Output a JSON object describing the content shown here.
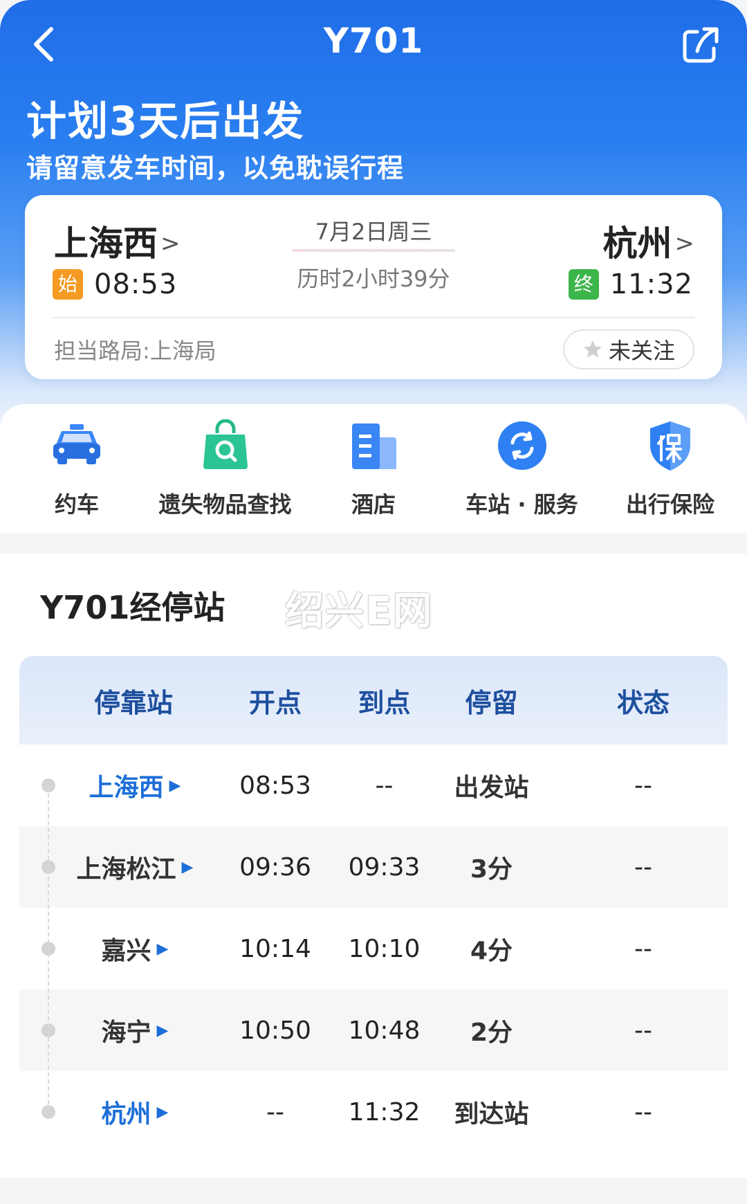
{
  "header": {
    "title": "Y701"
  },
  "plan": {
    "title": "计划3天后出发",
    "subtitle": "请留意发车时间，以免耽误行程"
  },
  "trip": {
    "from": {
      "name": "上海西",
      "badge": "始",
      "time": "08:53"
    },
    "to": {
      "name": "杭州",
      "badge": "终",
      "time": "11:32"
    },
    "date": "7月2日周三",
    "duration": "历时2小时39分",
    "bureau": "担当路局:上海局",
    "follow_label": "未关注"
  },
  "services": [
    {
      "label": "约车",
      "icon": "car-icon"
    },
    {
      "label": "遗失物品查找",
      "icon": "lost-item-bag-icon"
    },
    {
      "label": "酒店",
      "icon": "hotel-icon"
    },
    {
      "label": "车站 · 服务",
      "icon": "station-service-icon"
    },
    {
      "label": "出行保险",
      "icon": "insurance-shield-icon"
    }
  ],
  "stops": {
    "title": "Y701经停站",
    "watermark": "绍兴E网",
    "headers": {
      "station": "停靠站",
      "depart": "开点",
      "arrive": "到点",
      "stay": "停留",
      "status": "状态"
    },
    "rows": [
      {
        "station": "上海西",
        "depart": "08:53",
        "arrive": "--",
        "stay": "出发站",
        "status": "--"
      },
      {
        "station": "上海松江",
        "depart": "09:36",
        "arrive": "09:33",
        "stay": "3分",
        "status": "--"
      },
      {
        "station": "嘉兴",
        "depart": "10:14",
        "arrive": "10:10",
        "stay": "4分",
        "status": "--"
      },
      {
        "station": "海宁",
        "depart": "10:50",
        "arrive": "10:48",
        "stay": "2分",
        "status": "--"
      },
      {
        "station": "杭州",
        "depart": "--",
        "arrive": "11:32",
        "stay": "到达站",
        "status": "--"
      }
    ]
  },
  "colors": {
    "brand_blue": "#1f6de8",
    "table_header_text": "#1d4f9e",
    "terminal_station": "#1d6ed8",
    "start_badge": "#f59a23",
    "end_badge": "#3cb54a"
  }
}
